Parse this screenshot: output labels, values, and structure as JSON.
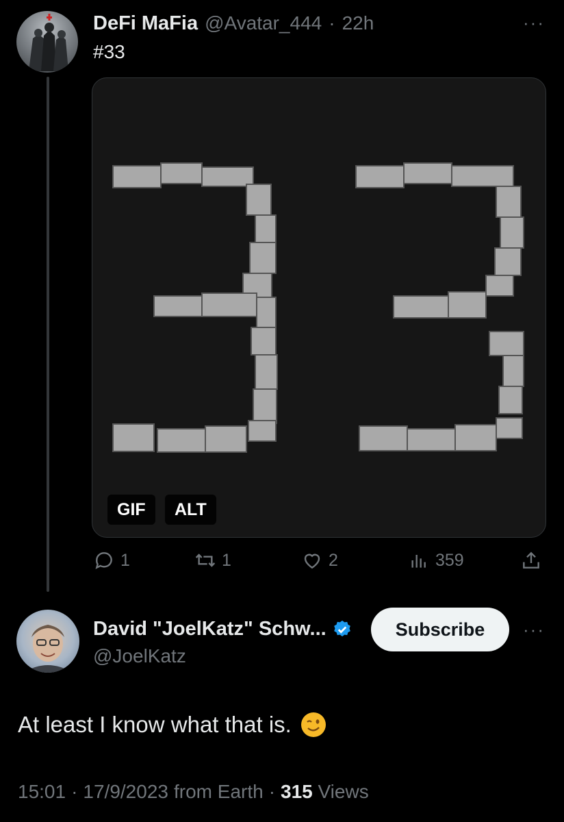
{
  "parent_tweet": {
    "display_name": "DeFi MaFia",
    "handle": "@Avatar_444",
    "separator": "·",
    "time": "22h",
    "text": "#33",
    "media_badges": {
      "gif": "GIF",
      "alt": "ALT"
    },
    "more_label": "···",
    "actions": {
      "reply_count": "1",
      "retweet_count": "1",
      "like_count": "2",
      "views_count": "359"
    }
  },
  "reply_tweet": {
    "display_name": "David \"JoelKatz\" Schw...",
    "handle": "@JoelKatz",
    "subscribe_label": "Subscribe",
    "more_label": "···",
    "text": "At least I know what that is.",
    "emoji": "wink-emoji",
    "meta": {
      "time": "15:01",
      "date": "17/9/2023",
      "source": "from Earth",
      "dot": "·",
      "views_number": "315",
      "views_label": "Views"
    }
  },
  "colors": {
    "background": "#000000",
    "text": "#e7e9ea",
    "muted": "#71767b",
    "verified": "#1d9bf0",
    "subscribe_bg": "#eff3f4"
  }
}
